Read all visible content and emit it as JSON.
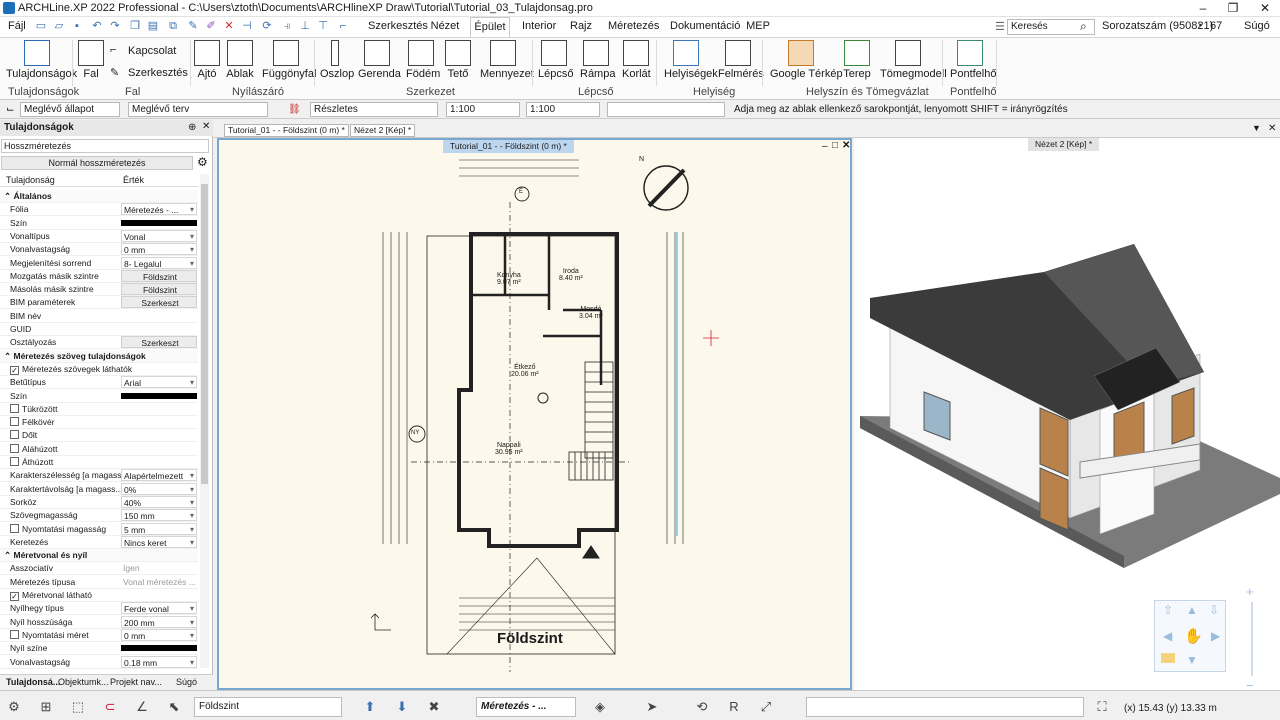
{
  "window": {
    "title": "ARCHLine.XP 2022 Professional - C:\\Users\\ztoth\\Documents\\ARCHlineXP Draw\\Tutorial\\Tutorial_03_Tulajdonsag.pro"
  },
  "menu": {
    "file_label": "Fájl",
    "tabs": [
      "Szerkesztés",
      "Nézet",
      "Épület",
      "Interior",
      "Rajz",
      "Méretezés",
      "Dokumentáció",
      "MEP"
    ],
    "active_tab": "Épület",
    "search_placeholder": "Keresés",
    "serial": "Sorozatszám (950821)",
    "timer": "67",
    "help": "Súgó"
  },
  "ribbon": {
    "tulajdonsagok": "Tulajdonságok",
    "fal": "Fal",
    "kapcsolat": "Kapcsolat",
    "szerkesztes": "Szerkesztés",
    "ajto": "Ajtó",
    "ablak": "Ablak",
    "fuggonyfal": "Függönyfal",
    "oszlop": "Oszlop",
    "gerenda": "Gerenda",
    "fodem": "Födém",
    "teto": "Tető",
    "mennyezet": "Mennyezet",
    "lepcso": "Lépcső",
    "rampa": "Rámpa",
    "korlat": "Korlát",
    "helyisegek": "Helyiségek",
    "felmeres": "Felmérés",
    "google": "Google Térkép",
    "terep": "Terep",
    "tomegmodell": "Tömegmodell",
    "pontfelho": "Pontfelhő",
    "groups": {
      "tulajdonsagok": "Tulajdonságok",
      "fal": "Fal",
      "nyilaszaro": "Nyílászáró",
      "szerkezet": "Szerkezet",
      "lepcso": "Lépcső",
      "helyiseg": "Helyiség",
      "helyszin": "Helyszín és Tömegvázlat",
      "pontfelho": "Pontfelhő"
    }
  },
  "options": {
    "state1": "Meglévő állapot",
    "state2": "Meglévő terv",
    "detail": "Részletes",
    "scale1": "1:100",
    "scale2": "1:100",
    "hint": "Adja meg az ablak ellenkező sarokpontját, lenyomott SHIFT = irányrögzítés"
  },
  "properties": {
    "header": "Tulajdonságok",
    "type": "Hosszméretezés",
    "style_button": "Normál hosszméretezés",
    "col_key": "Tulajdonság",
    "col_val": "Érték",
    "rows": [
      {
        "k": "Általános",
        "sec": true
      },
      {
        "k": "Fólia",
        "v": "Méretezés - ...",
        "t": "dd"
      },
      {
        "k": "Szín",
        "v": "",
        "t": "black"
      },
      {
        "k": "Vonaltípus",
        "v": "Vonal",
        "t": "dd"
      },
      {
        "k": "Vonalvastagság",
        "v": "0 mm",
        "t": "dd"
      },
      {
        "k": "Megjelenítési sorrend",
        "v": "8- Legalul",
        "t": "dd"
      },
      {
        "k": "Mozgatás másik szintre",
        "v": "Földszint",
        "t": "btn"
      },
      {
        "k": "Másolás másik szintre",
        "v": "Földszint",
        "t": "btn"
      },
      {
        "k": "BIM paraméterek",
        "v": "Szerkeszt",
        "t": "btn"
      },
      {
        "k": "BIM név",
        "v": "",
        "t": ""
      },
      {
        "k": "GUID",
        "v": "",
        "t": ""
      },
      {
        "k": "Osztályozás",
        "v": "Szerkeszt",
        "t": "btn"
      },
      {
        "k": "Méretezés szöveg tulajdonságok",
        "sec": true
      },
      {
        "k": "Méretezés szövegek láthatók",
        "cb": true,
        "checked": true
      },
      {
        "k": "Betűtípus",
        "v": "Arial",
        "t": "dd"
      },
      {
        "k": "Szín",
        "v": "",
        "t": "black"
      },
      {
        "k": "Tükrözött",
        "cb": true
      },
      {
        "k": "Félkövér",
        "cb": true
      },
      {
        "k": "Dőlt",
        "cb": true
      },
      {
        "k": "Aláhúzott",
        "cb": true
      },
      {
        "k": "Áthúzott",
        "cb": true
      },
      {
        "k": "Karakterszélesség [a magass...",
        "v": "Alapértelmezett",
        "t": "dd"
      },
      {
        "k": "Karaktertávolság [a magass...",
        "v": "0%",
        "t": "dd"
      },
      {
        "k": "Sorköz",
        "v": "40%",
        "t": "dd"
      },
      {
        "k": "Szövegmagasság",
        "v": "150 mm",
        "t": "dd"
      },
      {
        "k": "Nyomtatási magasság",
        "cb": true,
        "v": "5 mm",
        "t": "dd"
      },
      {
        "k": "Keretezés",
        "v": "Nincs keret",
        "t": "dd"
      },
      {
        "k": "Méretvonal és nyíl",
        "sec": true
      },
      {
        "k": "Asszociatív",
        "v": "Igen",
        "t": "grey"
      },
      {
        "k": "Méretezés típusa",
        "v": "Vonal méretezés ...",
        "t": "grey"
      },
      {
        "k": "Méretvonal látható",
        "cb": true,
        "checked": true
      },
      {
        "k": "Nyílhegy típus",
        "v": "Ferde vonal",
        "t": "dd"
      },
      {
        "k": "Nyíl hosszúsága",
        "v": "200 mm",
        "t": "dd"
      },
      {
        "k": "Nyomtatási méret",
        "cb": true,
        "v": "0 mm",
        "t": "dd"
      },
      {
        "k": "Nyíl színe",
        "v": "",
        "t": "black"
      },
      {
        "k": "Vonalvastagság",
        "v": "0.18 mm",
        "t": "dd"
      }
    ],
    "tabs": [
      "Tulajdonsá...",
      "Objektumk...",
      "Projekt nav...",
      "Súgó"
    ]
  },
  "documents": {
    "tab1": "Tutorial_01 - - Földszint (0 m) *",
    "tab2": "Nézet 2 [Kép] *",
    "view2d_title": "Tutorial_01 - - Földszint (0 m) *",
    "view3d_title": "Nézet 2 [Kép] *"
  },
  "plan": {
    "rooms": [
      {
        "name": "Konyha",
        "area": "9.07 m²"
      },
      {
        "name": "Iroda",
        "area": "8.40 m²"
      },
      {
        "name": "Mosdó",
        "area": "3.04 m²"
      },
      {
        "name": "Étkező",
        "area": "20.06 m²"
      },
      {
        "name": "Nappali",
        "area": "30.95 m²"
      }
    ],
    "level_label": "Földszint",
    "marker_e": "É",
    "marker_ny": "NY",
    "compass_n": "N"
  },
  "status": {
    "level": "Földszint",
    "layer": "Méretezés - ...",
    "coords": "(x) 15.43  (y) 13.33 m"
  }
}
